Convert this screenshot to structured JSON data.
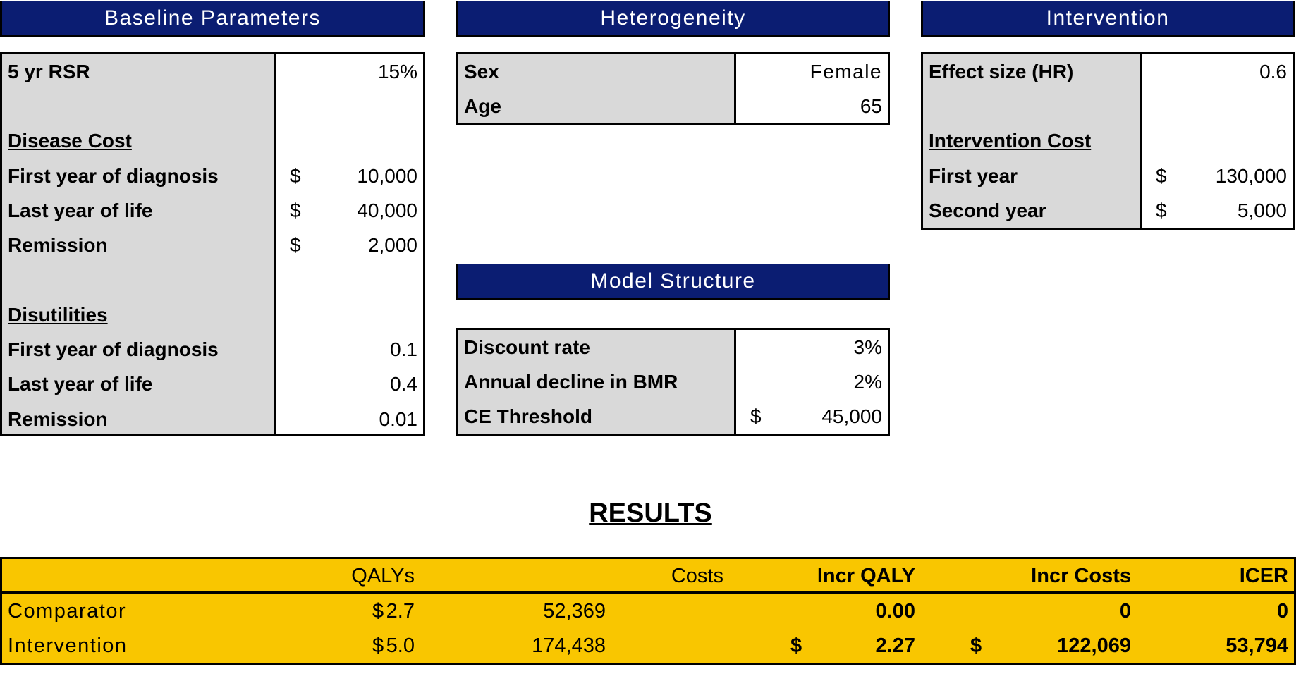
{
  "colors": {
    "header_bg": "#0b1d72",
    "label_bg": "#d9d9d9",
    "results_bg": "#f9c600"
  },
  "baseline": {
    "title": "Baseline Parameters",
    "rows": [
      {
        "label": "5 yr RSR",
        "value": "15%",
        "currency": ""
      },
      {
        "label": "",
        "value": "",
        "currency": ""
      },
      {
        "label": "Disease Cost",
        "value": "",
        "currency": "",
        "section": true
      },
      {
        "label": "First year of diagnosis",
        "value": "10,000",
        "currency": "$"
      },
      {
        "label": "Last year of life",
        "value": "40,000",
        "currency": "$"
      },
      {
        "label": "Remission",
        "value": "2,000",
        "currency": "$"
      },
      {
        "label": "",
        "value": "",
        "currency": ""
      },
      {
        "label": "Disutilities",
        "value": "",
        "currency": "",
        "section": true
      },
      {
        "label": "First year of diagnosis",
        "value": "0.1",
        "currency": ""
      },
      {
        "label": "Last year of life",
        "value": "0.4",
        "currency": ""
      },
      {
        "label": "Remission",
        "value": "0.01",
        "currency": ""
      }
    ]
  },
  "heterogeneity": {
    "title": "Heterogeneity",
    "rows": [
      {
        "label": "Sex",
        "value": "Female"
      },
      {
        "label": "Age",
        "value": "65"
      }
    ]
  },
  "model_structure": {
    "title": "Model Structure",
    "rows": [
      {
        "label": "Discount rate",
        "value": "3%",
        "currency": ""
      },
      {
        "label": "Annual decline in BMR",
        "value": "2%",
        "currency": ""
      },
      {
        "label": "CE Threshold",
        "value": "45,000",
        "currency": "$"
      }
    ]
  },
  "intervention": {
    "title": "Intervention",
    "rows": [
      {
        "label": "Effect size (HR)",
        "value": "0.6",
        "currency": ""
      },
      {
        "label": "",
        "value": "",
        "currency": ""
      },
      {
        "label": "Intervention Cost",
        "value": "",
        "currency": "",
        "section": true
      },
      {
        "label": "First year",
        "value": "130,000",
        "currency": "$"
      },
      {
        "label": "Second year",
        "value": "5,000",
        "currency": "$"
      }
    ]
  },
  "results": {
    "title": "RESULTS",
    "headers": {
      "qalys": "QALYs",
      "costs": "Costs",
      "incr_qaly": "Incr QALY",
      "incr_costs": "Incr Costs",
      "icer": "ICER"
    },
    "rows": [
      {
        "label": "Comparator",
        "qalys": "2.7",
        "costs_currency": "$",
        "costs": "52,369",
        "incr_qaly": "0.00",
        "incr_costs_currency": "",
        "incr_costs": "0",
        "icer_currency": "",
        "icer": "0"
      },
      {
        "label": "Intervention",
        "qalys": "5.0",
        "costs_currency": "$",
        "costs": "174,438",
        "incr_qaly": "2.27",
        "incr_costs_currency": "$",
        "incr_costs": "122,069",
        "icer_currency": "$",
        "icer": "53,794"
      }
    ]
  }
}
